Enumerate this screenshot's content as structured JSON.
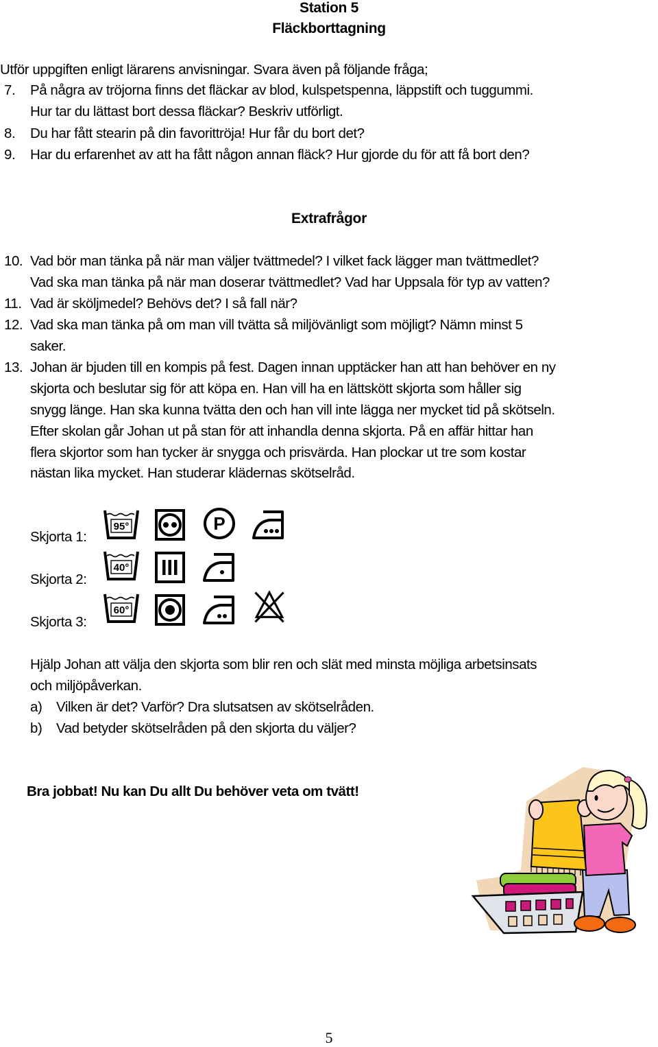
{
  "header": {
    "station": "Station 5",
    "subtitle": "Fläckborttagning"
  },
  "intro": "Utför uppgiften enligt lärarens anvisningar. Svara även på följande fråga;",
  "questions_main": [
    {
      "num": "7.",
      "lines": [
        "På några av tröjorna finns det fläckar av blod, kulspetspenna, läppstift och tuggummi.",
        "Hur tar du lättast bort dessa fläckar? Beskriv utförligt."
      ]
    },
    {
      "num": "8.",
      "lines": [
        "Du har fått stearin på din favorittröja! Hur får du bort det?"
      ]
    },
    {
      "num": "9.",
      "lines": [
        "Har du erfarenhet av att ha fått någon annan fläck? Hur gjorde du för att få bort den?"
      ]
    }
  ],
  "extra_heading": "Extrafrågor",
  "questions_extra": [
    {
      "num": "10.",
      "lines": [
        "Vad bör man tänka på när man väljer tvättmedel? I vilket fack lägger man tvättmedlet?",
        "Vad ska man tänka på när man doserar tvättmedlet? Vad har Uppsala för typ av vatten?"
      ]
    },
    {
      "num": "11.",
      "lines": [
        "Vad är sköljmedel? Behövs det? I så fall när?"
      ]
    },
    {
      "num": "12.",
      "lines": [
        "Vad ska man tänka på om man vill tvätta så miljövänligt som möjligt? Nämn minst 5",
        "saker."
      ]
    },
    {
      "num": "13.",
      "lines": [
        "Johan är bjuden till en kompis på fest. Dagen innan upptäcker han att han behöver en ny",
        "skjorta och beslutar sig för att köpa en. Han vill ha en lättskött skjorta som håller sig",
        "snygg länge. Han ska kunna tvätta den och han vill inte lägga ner mycket tid på skötseln.",
        "Efter skolan går Johan ut på stan för att inhandla denna skjorta. På en affär hittar han",
        "flera skjortor som han tycker är snygga och prisvärda. Han plockar ut tre som kostar",
        "nästan lika mycket. Han studerar klädernas skötselråd."
      ]
    }
  ],
  "shirts": [
    {
      "label": "Skjorta 1:",
      "wash_temp": "95°",
      "symbols": [
        "wash-95-icon",
        "tumble-dry-high-icon",
        "dry-clean-p-icon",
        "iron-high-icon"
      ]
    },
    {
      "label": "Skjorta 2:",
      "wash_temp": "40°",
      "symbols": [
        "wash-40-icon",
        "drip-dry-icon",
        "iron-low-icon"
      ]
    },
    {
      "label": "Skjorta 3:",
      "wash_temp": "60°",
      "symbols": [
        "wash-60-icon",
        "tumble-dry-normal-icon",
        "iron-medium-icon",
        "no-bleach-icon"
      ]
    }
  ],
  "task": {
    "lines": [
      "Hjälp Johan att välja den skjorta som blir ren och slät med minsta möjliga arbetsinsats",
      "och miljöpåverkan."
    ],
    "subquestions": [
      {
        "marker": "a)",
        "text": "Vilken är det? Varför? Dra slutsatsen av skötselråden."
      },
      {
        "marker": "b)",
        "text": "Vad betyder skötselråden på den skjorta du väljer?"
      }
    ]
  },
  "closing": "Bra jobbat! Nu kan Du allt Du behöver veta om tvätt!",
  "illustration": "girl-folding-laundry-clipart",
  "page_number": "5"
}
